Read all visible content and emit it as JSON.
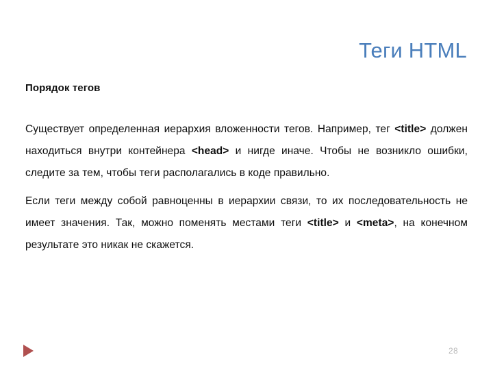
{
  "slide": {
    "title": "Теги HTML",
    "subheading": "Порядок тегов",
    "title_color": "#4a7ebb",
    "body_color": "#0d0d0d",
    "accent_color": "#b0504f",
    "page_number_color": "#b8b8b8",
    "background_color": "#ffffff"
  },
  "paragraphs": [
    {
      "id": "paragraph-1",
      "runs": [
        {
          "text": "Существует определенная иерархия вложенности тегов. Например, тег ",
          "bold": false
        },
        {
          "text": "<title>",
          "bold": true
        },
        {
          "text": " должен находиться внутри контейнера ",
          "bold": false
        },
        {
          "text": "<head>",
          "bold": true
        },
        {
          "text": " и нигде иначе. Чтобы не возникло ошибки, следите за тем, чтобы теги располагались в коде правильно.",
          "bold": false
        }
      ]
    },
    {
      "id": "paragraph-2",
      "runs": [
        {
          "text": "Если теги между собой равноценны в иерархии связи, то их последовательность не имеет значения. Так, можно поменять местами теги ",
          "bold": false
        },
        {
          "text": "<title>",
          "bold": true
        },
        {
          "text": " и ",
          "bold": false
        },
        {
          "text": "<meta>",
          "bold": true
        },
        {
          "text": ", на конечном результате это никак не скажется.",
          "bold": false
        }
      ]
    }
  ],
  "footer": {
    "bullet_icon": "triangle-right-icon",
    "page_number": "28"
  }
}
